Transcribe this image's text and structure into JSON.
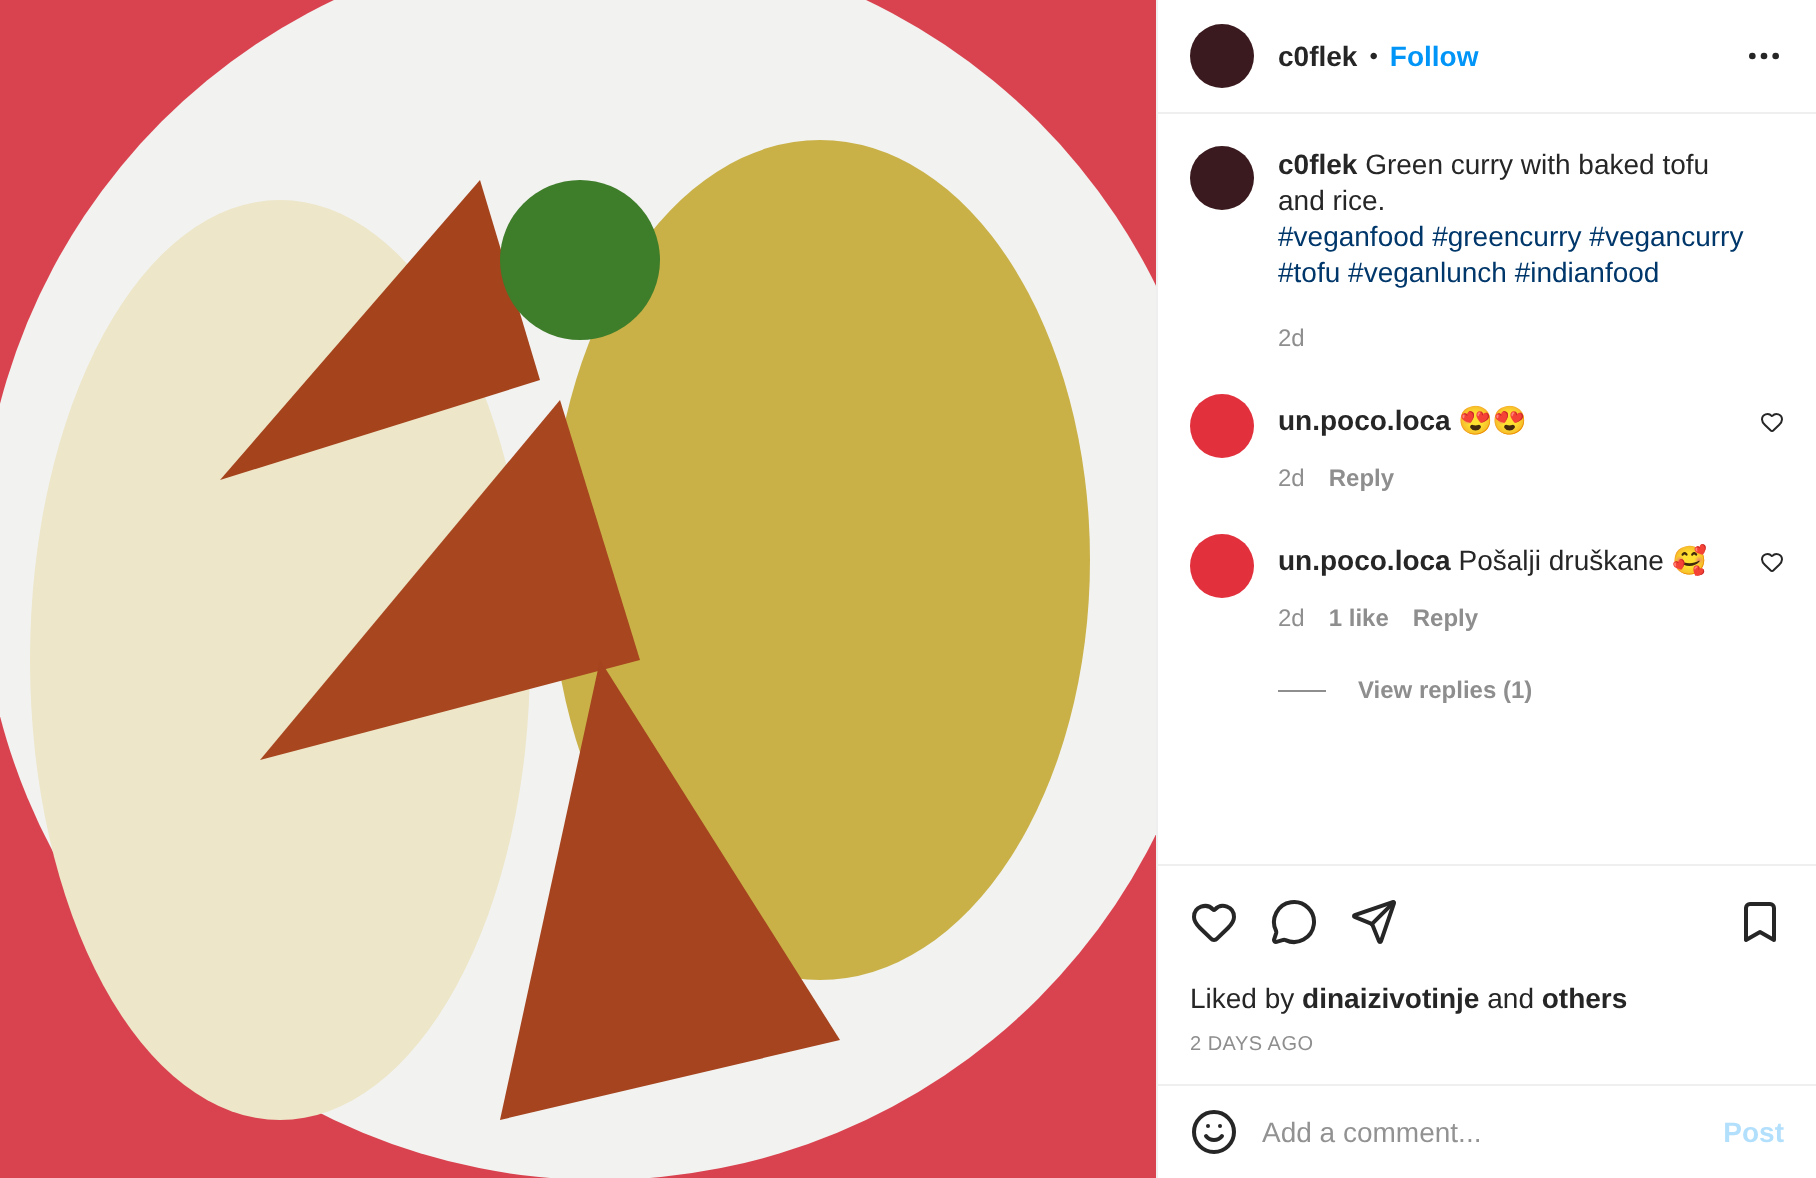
{
  "header": {
    "username": "c0flek",
    "separator": "•",
    "follow": "Follow"
  },
  "caption": {
    "text": "**c0flek** Green curry with baked tofu and rice.",
    "hashtags": "#veganfood #greencurry #vegancurry #tofu #veganlunch #indianfood",
    "time": "2d"
  },
  "comments": [
    {
      "username": "un.poco.loca",
      "text": "😍😍",
      "time": "2d",
      "reply": "Reply",
      "liked": false
    },
    {
      "username": "un.poco.loca",
      "text": "Pošalji druškane 🥰",
      "time": "2d",
      "likes": "1 like",
      "reply": "Reply",
      "liked": false,
      "view_replies": "View replies (1)"
    }
  ],
  "actions": {
    "liked": false,
    "saved": false
  },
  "likes": "Liked by **dinaizivotinje** and **others**",
  "date": "2 DAYS AGO",
  "comment_box": {
    "placeholder": "Add a comment...",
    "post": "Post",
    "post_disabled": true
  }
}
